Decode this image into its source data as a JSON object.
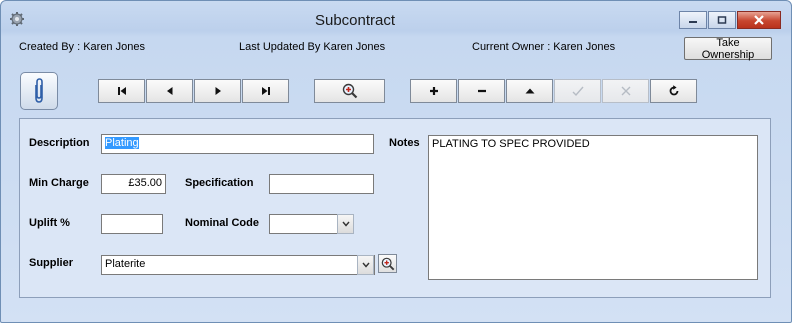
{
  "window": {
    "title": "Subcontract"
  },
  "info": {
    "created_by": "Created By :  Karen Jones",
    "last_updated": "Last Updated By Karen Jones",
    "current_owner": "Current Owner :  Karen Jones",
    "take_ownership": "Take Ownership"
  },
  "toolbar": {
    "icons": [
      "paperclip-icon",
      "first-record-icon",
      "previous-record-icon",
      "next-record-icon",
      "last-record-icon",
      "search-icon",
      "add-icon",
      "delete-icon",
      "up-icon",
      "save-check-icon",
      "cancel-x-icon",
      "refresh-icon"
    ]
  },
  "form": {
    "description_label": "Description",
    "description_value": "Plating",
    "min_charge_label": "Min Charge",
    "min_charge_value": "£35.00",
    "specification_label": "Specification",
    "specification_value": "",
    "uplift_label": "Uplift %",
    "uplift_value": "",
    "nominal_code_label": "Nominal Code",
    "nominal_code_value": "",
    "supplier_label": "Supplier",
    "supplier_value": "Platerite",
    "notes_label": "Notes",
    "notes_value": "PLATING TO SPEC PROVIDED"
  },
  "colors": {
    "title_bar": "#c9daf1",
    "panel": "#dbe6f6",
    "selection": "#3399ff",
    "close_button": "#c7462f"
  }
}
